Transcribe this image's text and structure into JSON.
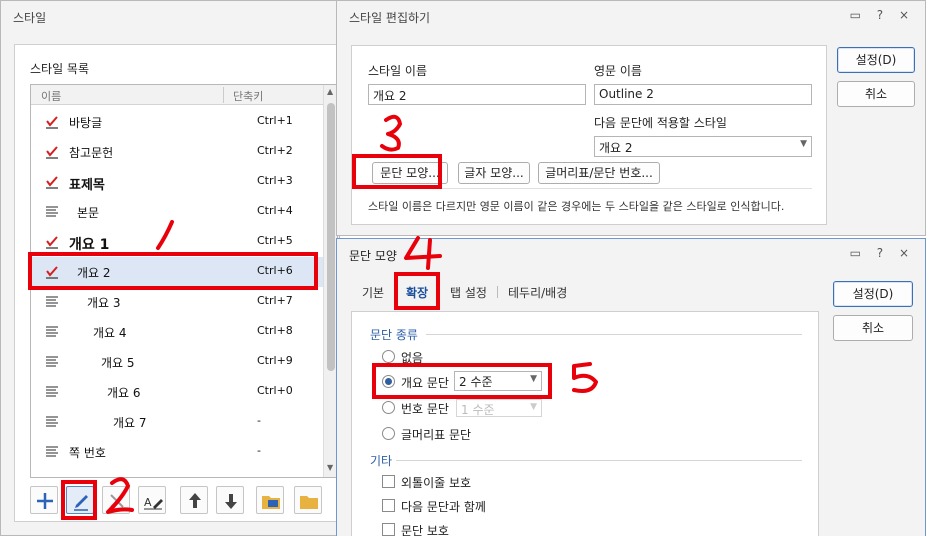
{
  "style_dialog": {
    "title": "스타일",
    "list_heading": "스타일 목록",
    "col_name": "이름",
    "col_shortcut": "단축키",
    "items": [
      {
        "name": "바탕글",
        "shortcut": "Ctrl+1"
      },
      {
        "name": "참고문헌",
        "shortcut": "Ctrl+2"
      },
      {
        "name": "표제목",
        "shortcut": "Ctrl+3"
      },
      {
        "name": "본문",
        "shortcut": "Ctrl+4"
      },
      {
        "name": "개요 1",
        "shortcut": "Ctrl+5"
      },
      {
        "name": "개요 2",
        "shortcut": "Ctrl+6"
      },
      {
        "name": "개요 3",
        "shortcut": "Ctrl+7"
      },
      {
        "name": "개요 4",
        "shortcut": "Ctrl+8"
      },
      {
        "name": "개요 5",
        "shortcut": "Ctrl+9"
      },
      {
        "name": "개요 6",
        "shortcut": "Ctrl+0"
      },
      {
        "name": "개요 7",
        "shortcut": "-"
      },
      {
        "name": "쪽 번호",
        "shortcut": "-"
      }
    ]
  },
  "edit_dialog": {
    "title": "스타일 편집하기",
    "name_label": "스타일 이름",
    "name_value": "개요 2",
    "eng_label": "영문 이름",
    "eng_value": "Outline 2",
    "next_label": "다음 문단에 적용할 스타일",
    "next_value": "개요 2",
    "para_shape_button": "문단 모양...",
    "char_shape_button": "글자 모양...",
    "bullet_button": "글머리표/문단 번호...",
    "note": "스타일 이름은 다르지만 영문 이름이 같은 경우에는 두 스타일을 같은 스타일로 인식합니다.",
    "ok_button": "설정(D)",
    "cancel_button": "취소"
  },
  "para_dialog": {
    "title": "문단 모양",
    "tabs": [
      "기본",
      "확장",
      "탭 설정",
      "테두리/배경"
    ],
    "section_type": "문단 종류",
    "opt_none": "없음",
    "opt_outline": "개요 문단",
    "outline_level": "2 수준",
    "opt_number": "번호 문단",
    "number_level": "1 수준",
    "opt_bullet": "글머리표 문단",
    "section_etc": "기타",
    "chk_orphan": "외톨이줄 보호",
    "chk_keep_next": "다음 문단과 함께",
    "chk_protect": "문단 보호",
    "ok_button": "설정(D)",
    "cancel_button": "취소"
  },
  "window_icons": "▭ ? ×",
  "annotations": [
    "1",
    "2",
    "3",
    "4",
    "5"
  ],
  "colors": {
    "accent": "#3b6fb6",
    "annotation": "#e8000b",
    "selection": "#dce6f4"
  }
}
